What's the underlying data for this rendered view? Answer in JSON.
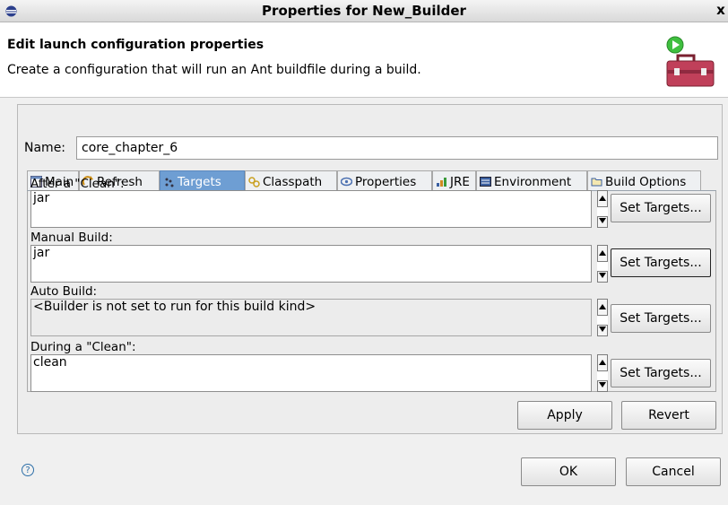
{
  "window": {
    "title": "Properties for New_Builder",
    "close_label": "x"
  },
  "header": {
    "title": "Edit launch configuration properties",
    "description": "Create a configuration that will run an Ant buildfile during a build."
  },
  "name": {
    "label": "Name:",
    "value": "core_chapter_6"
  },
  "tabs": [
    {
      "label": "Main",
      "icon": "main-tab-icon",
      "active": false
    },
    {
      "label": "Refresh",
      "icon": "refresh-icon",
      "active": false
    },
    {
      "label": "Targets",
      "icon": "targets-icon",
      "active": true
    },
    {
      "label": "Classpath",
      "icon": "classpath-icon",
      "active": false
    },
    {
      "label": "Properties",
      "icon": "properties-icon",
      "active": false
    },
    {
      "label": "JRE",
      "icon": "jre-icon",
      "active": false
    },
    {
      "label": "Environment",
      "icon": "environment-icon",
      "active": false
    },
    {
      "label": "Build Options",
      "icon": "build-options-icon",
      "active": false
    }
  ],
  "sections": [
    {
      "label": "After a \"Clean\":",
      "value": "jar",
      "button": "Set Targets...",
      "enabled": true
    },
    {
      "label": "Manual Build:",
      "value": "jar",
      "button": "Set Targets...",
      "enabled": true
    },
    {
      "label": "Auto Build:",
      "value": "<Builder is not set to run for this build kind>",
      "button": "Set Targets...",
      "enabled": false
    },
    {
      "label": "During a \"Clean\":",
      "value": "clean",
      "button": "Set Targets...",
      "enabled": true
    }
  ],
  "actions": {
    "apply": "Apply",
    "revert": "Revert",
    "ok": "OK",
    "cancel": "Cancel"
  },
  "help": {
    "icon": "help-icon",
    "glyph": "?"
  },
  "colors": {
    "active_tab": "#6e9ed3",
    "toolbox_icon": "#c0405a"
  }
}
